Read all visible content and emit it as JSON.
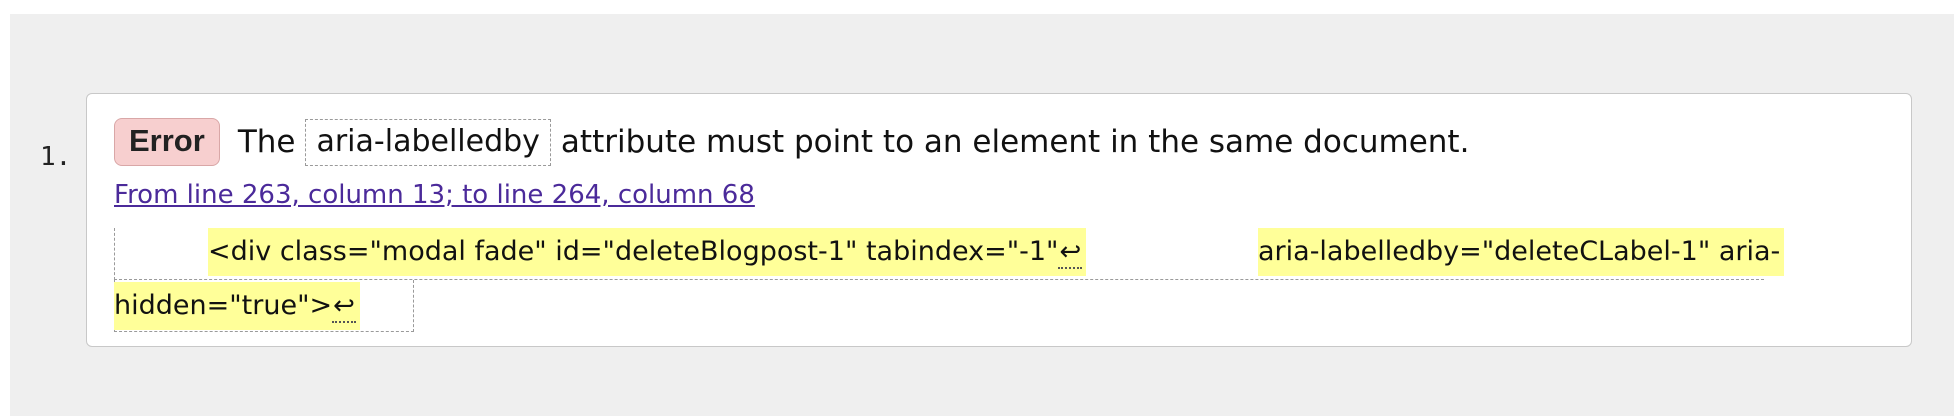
{
  "list": {
    "marker": "1."
  },
  "message": {
    "badge": "Error",
    "text_before": "The",
    "code": "aria-labelledby",
    "text_after": "attribute must point to an element in the same document."
  },
  "location": {
    "text": "From line 263, column 13; to line 264, column 68"
  },
  "extract": {
    "segment1": "<div class=\"modal fade\" id=\"deleteBlogpost-1\" tabindex=\"-1\"",
    "return_glyph": "↩",
    "segment2": "aria-labelledby=\"deleteCLabel-1\" aria-",
    "segment3": "hidden=\"true\">"
  },
  "colors": {
    "badge_bg": "#f7cfcf",
    "highlight": "#ffff99",
    "link": "#4b2a9a",
    "page_bg": "#efefef"
  }
}
